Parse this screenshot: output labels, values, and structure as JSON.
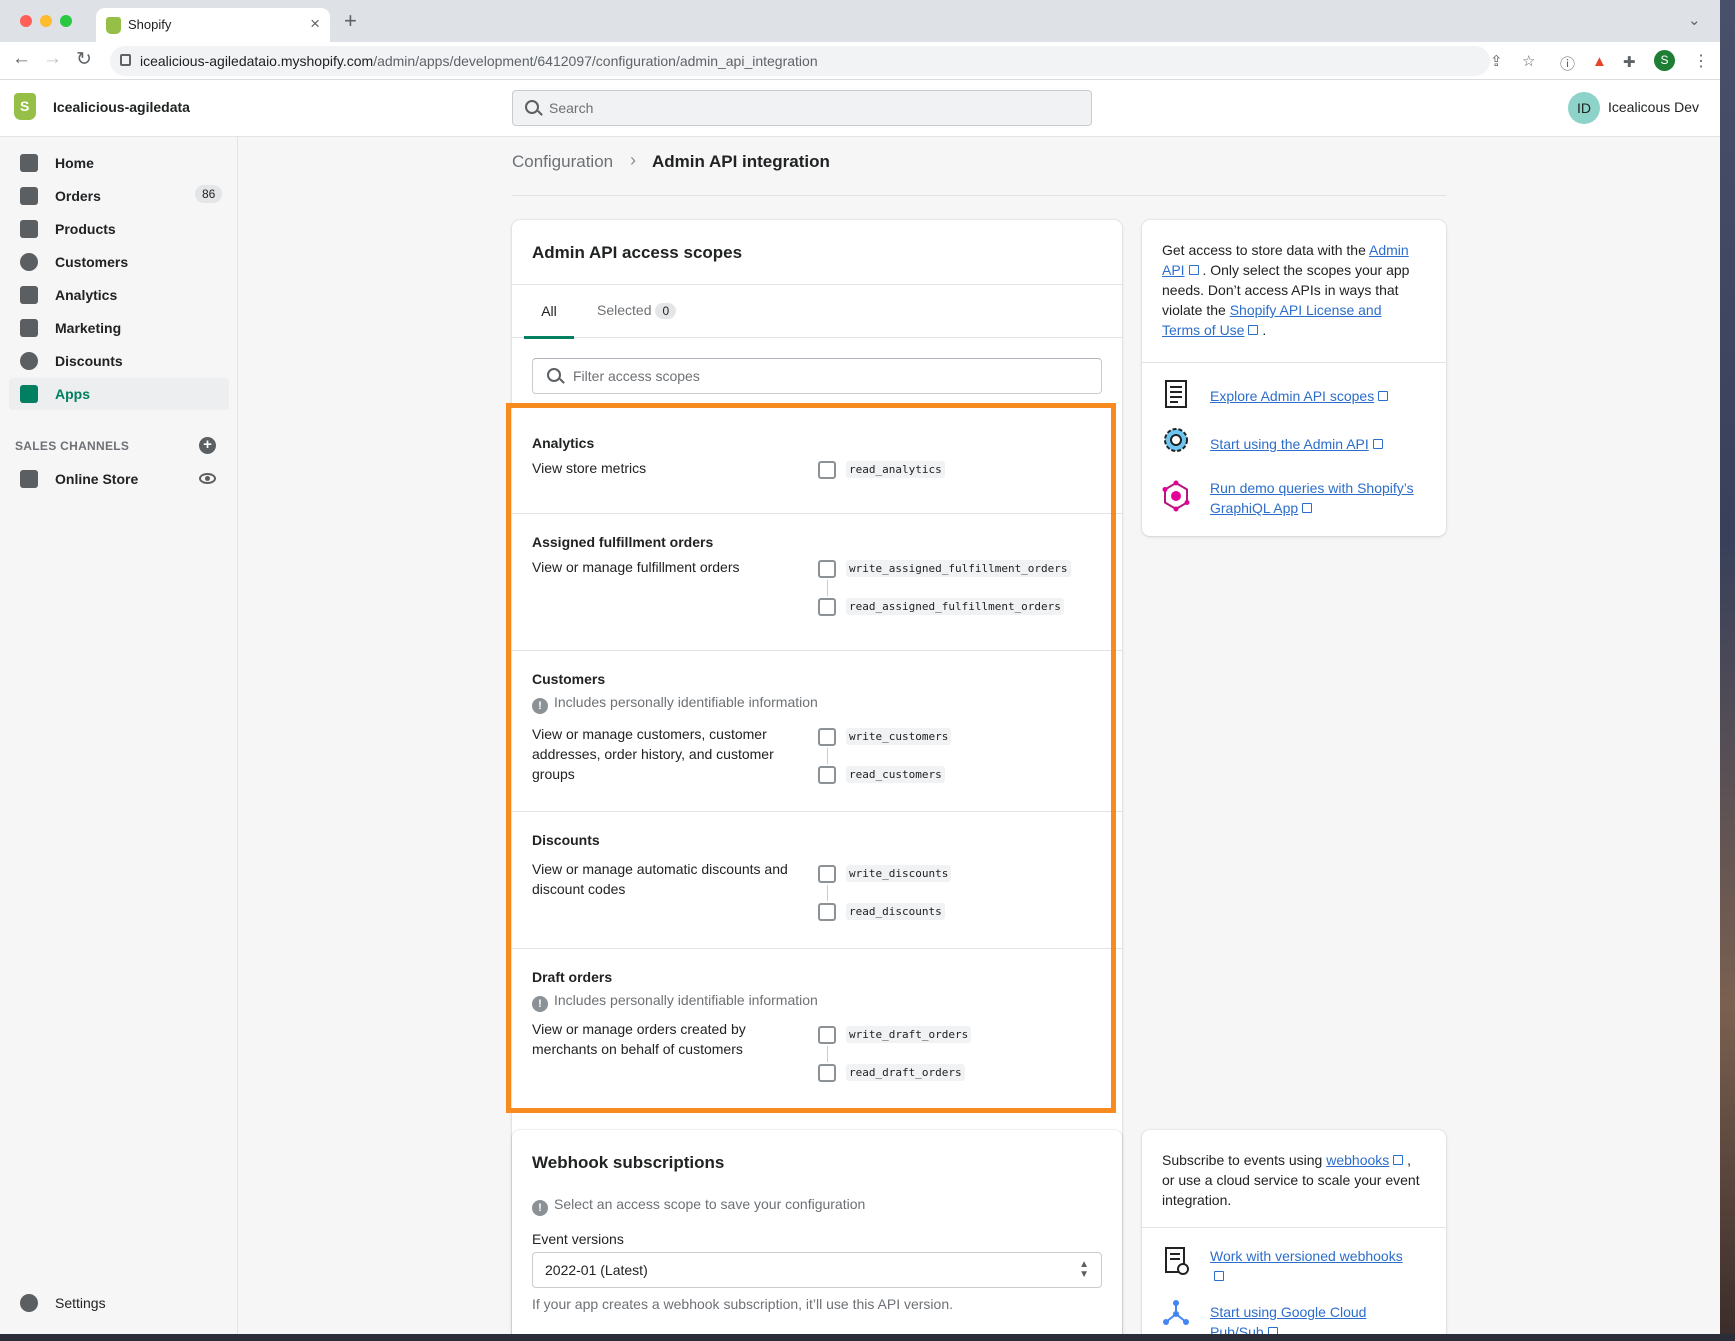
{
  "browser": {
    "tab_title": "Shopify",
    "url_host": "icealicious-agiledataio.myshopify.com",
    "url_path": "/admin/apps/development/6412097/configuration/admin_api_integration",
    "profile_initial": "S"
  },
  "topbar": {
    "store_name": "Icealicious-agiledata",
    "search_placeholder": "Search",
    "user_initials": "ID",
    "user_name": "Icealicous Dev"
  },
  "sidebar": {
    "items": [
      {
        "label": "Home",
        "icon": "home-icon"
      },
      {
        "label": "Orders",
        "icon": "orders-icon",
        "badge": "86"
      },
      {
        "label": "Products",
        "icon": "tag-icon"
      },
      {
        "label": "Customers",
        "icon": "person-icon"
      },
      {
        "label": "Analytics",
        "icon": "bar-chart-icon"
      },
      {
        "label": "Marketing",
        "icon": "megaphone-icon"
      },
      {
        "label": "Discounts",
        "icon": "discount-icon"
      },
      {
        "label": "Apps",
        "icon": "apps-icon",
        "active": true
      }
    ],
    "sales_channels_title": "SALES CHANNELS",
    "online_store": "Online Store",
    "settings": "Settings"
  },
  "breadcrumb": {
    "parent": "Configuration",
    "current": "Admin API integration"
  },
  "scopes_card": {
    "title": "Admin API access scopes",
    "tab_all": "All",
    "tab_selected": "Selected",
    "selected_count": "0",
    "filter_placeholder": "Filter access scopes",
    "pii_note": "Includes personally identifiable information",
    "sections": [
      {
        "title": "Analytics",
        "desc": "View store metrics",
        "scopes": [
          "read_analytics"
        ]
      },
      {
        "title": "Assigned fulfillment orders",
        "desc": "View or manage fulfillment orders",
        "scopes": [
          "write_assigned_fulfillment_orders",
          "read_assigned_fulfillment_orders"
        ]
      },
      {
        "title": "Customers",
        "pii": true,
        "desc": "View or manage customers, customer addresses, order history, and customer groups",
        "scopes": [
          "write_customers",
          "read_customers"
        ]
      },
      {
        "title": "Discounts",
        "desc": "View or manage automatic discounts and discount codes",
        "scopes": [
          "write_discounts",
          "read_discounts"
        ]
      },
      {
        "title": "Draft orders",
        "pii": true,
        "desc": "View or manage orders created by merchants on behalf of customers",
        "scopes": [
          "write_draft_orders",
          "read_draft_orders"
        ]
      }
    ]
  },
  "info_card": {
    "text_1": "Get access to store data with the",
    "link_admin_api": "Admin API",
    "text_2": ". Only select the scopes your app needs. Don’t access APIs in ways that violate the",
    "link_license": "Shopify API License and Terms of Use",
    "text_3": ".",
    "links": [
      "Explore Admin API scopes",
      "Start using the Admin API",
      "Run demo queries with Shopify’s GraphiQL App"
    ]
  },
  "webhook_card": {
    "title": "Webhook subscriptions",
    "note": "Select an access scope to save your configuration",
    "event_versions_label": "Event versions",
    "event_version_value": "2022-01 (Latest)",
    "help_text": "If your app creates a webhook subscription, it’ll use this API version."
  },
  "webhook_info_card": {
    "text_1": "Subscribe to events using",
    "link_webhooks": "webhooks",
    "text_2": ", or use a cloud service to scale your event integration.",
    "links": [
      "Work with versioned webhooks",
      "Start using Google Cloud Pub/Sub"
    ]
  },
  "colors": {
    "accent": "#008060",
    "highlight": "#f78b1f",
    "link": "#2c6ecb"
  }
}
